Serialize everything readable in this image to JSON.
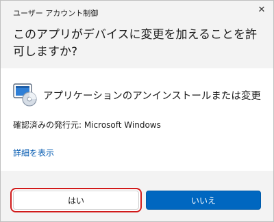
{
  "window": {
    "title": "ユーザー アカウント制御",
    "close_glyph": "✕"
  },
  "prompt": {
    "text": "このアプリがデバイスに変更を加えることを許可しますか?"
  },
  "app": {
    "name": "アプリケーションのアンインストールまたは変更",
    "icon": "programs-and-features-icon",
    "publisher": "確認済みの発行元: Microsoft Windows"
  },
  "details": {
    "label": "詳細を表示"
  },
  "buttons": {
    "yes": "はい",
    "no": "いいえ"
  },
  "colors": {
    "accent": "#0067c0",
    "link": "#0058b0",
    "focus_highlight": "#d11a1a"
  }
}
